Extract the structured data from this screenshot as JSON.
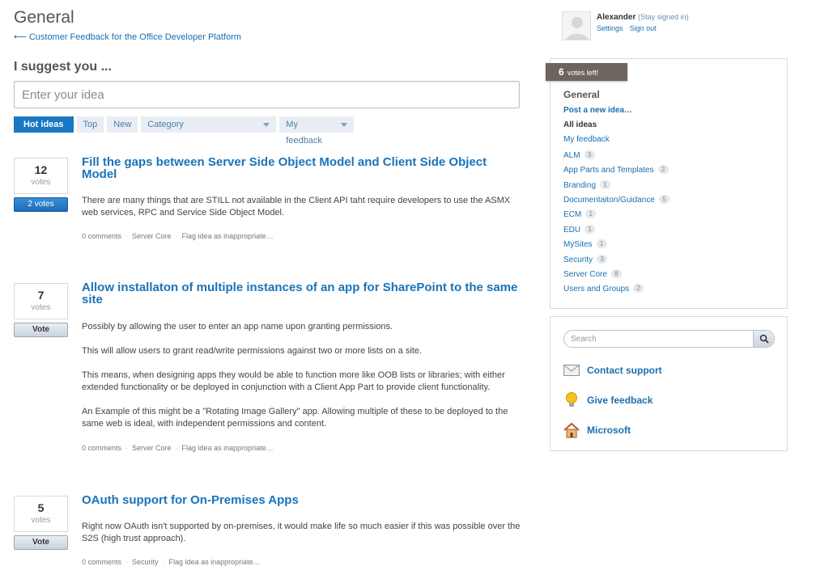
{
  "header": {
    "title": "General",
    "breadcrumb": "⟵ Customer Feedback for the Office Developer Platform"
  },
  "suggest": {
    "label": "I suggest you ...",
    "placeholder": "Enter your idea"
  },
  "filters": {
    "hot": "Hot ideas",
    "top": "Top",
    "new": "New",
    "category": "Category",
    "my_feedback": "My feedback"
  },
  "ideas": [
    {
      "votes": "12",
      "votes_label": "votes",
      "button": "2 votes",
      "title": "Fill the gaps between Server Side Object Model and Client Side Object Model",
      "body": [
        "There are many things that are STILL not available in the Client API taht require developers to use the ASMX web services, RPC and Service Side Object Model."
      ],
      "comments": "0 comments",
      "category": "Server Core",
      "flag": "Flag idea as inappropriate…"
    },
    {
      "votes": "7",
      "votes_label": "votes",
      "button": "Vote",
      "title": "Allow installaton of multiple instances of an app for SharePoint to the same site",
      "body": [
        "Possibly by allowing the user to enter an app name upon granting permissions.",
        "This will allow users to grant read/write permissions against two or more lists on a site.",
        "This means, when designing apps they would be able to function more like OOB lists or libraries; with either extended functionality or be deployed in conjunction with a Client App Part to provide client functionality.",
        "An Example of this might be a \"Rotating Image Gallery\" app. Allowing multiple of these to be deployed to the same web is ideal, with independent permissions and content."
      ],
      "comments": "0 comments",
      "category": "Server Core",
      "flag": "Flag idea as inappropriate…"
    },
    {
      "votes": "5",
      "votes_label": "votes",
      "button": "Vote",
      "title": "OAuth support for On-Premises Apps",
      "body": [
        "Right now OAuth isn't supported by on-premises, it would make life so much easier if this was possible over the S2S (high trust approach)."
      ],
      "comments": "0 comments",
      "category": "Security",
      "flag": "Flag idea as inappropriate…"
    }
  ],
  "user": {
    "name": "Alexander",
    "stay_signed_in": "(Stay signed in)",
    "settings": "Settings",
    "sign_out": "Sign out"
  },
  "sidebar": {
    "votes_left_count": "6",
    "votes_left_text": "votes left!",
    "forum_title": "General",
    "post_idea": "Post a new idea…",
    "items": [
      {
        "label": "All ideas",
        "count": ""
      },
      {
        "label": "My feedback",
        "count": ""
      },
      {
        "label": "ALM",
        "count": "3"
      },
      {
        "label": "App Parts and Templates",
        "count": "2"
      },
      {
        "label": "Branding",
        "count": "1"
      },
      {
        "label": "Documentaiton/Guidance",
        "count": "5"
      },
      {
        "label": "ECM",
        "count": "1"
      },
      {
        "label": "EDU",
        "count": "1"
      },
      {
        "label": "MySites",
        "count": "1"
      },
      {
        "label": "Security",
        "count": "3"
      },
      {
        "label": "Server Core",
        "count": "8"
      },
      {
        "label": "Users and Groups",
        "count": "2"
      }
    ],
    "search_placeholder": "Search",
    "contact_support": "Contact support",
    "give_feedback": "Give feedback",
    "microsoft": "Microsoft"
  }
}
